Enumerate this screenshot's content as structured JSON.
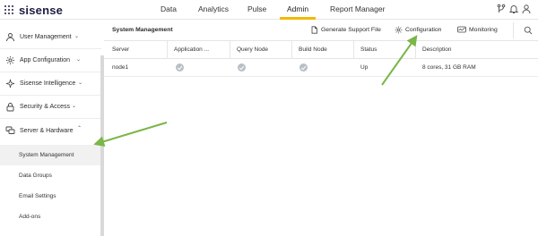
{
  "app": {
    "logo_text": "sisense"
  },
  "topnav": {
    "items": [
      "Data",
      "Analytics",
      "Pulse",
      "Admin",
      "Report Manager"
    ],
    "active": "Admin"
  },
  "top_icons": [
    "branch-icon",
    "bell-icon",
    "user-icon"
  ],
  "sidebar": {
    "sections": [
      {
        "label": "User Management",
        "icon": "user-icon",
        "chevron": "down"
      },
      {
        "label": "App Configuration",
        "icon": "gear-icon",
        "chevron": "down"
      },
      {
        "label": "Sisense Intelligence",
        "icon": "sparkle-icon",
        "chevron": "down"
      },
      {
        "label": "Security & Access",
        "icon": "lock-icon",
        "chevron": "down"
      },
      {
        "label": "Server & Hardware",
        "icon": "server-icon",
        "chevron": "up"
      }
    ],
    "sub_items": [
      "System Management",
      "Data Groups",
      "Email Settings",
      "Add-ons"
    ],
    "selected_sub_item": "System Management"
  },
  "main": {
    "title": "System Management",
    "buttons": {
      "generate_support_file": "Generate Support File",
      "configuration": "Configuration",
      "monitoring": "Monitoring"
    },
    "table": {
      "columns": [
        "Server",
        "Application ...",
        "Query Node",
        "Build Node",
        "Status",
        "Description"
      ],
      "rows": [
        {
          "server": "node1",
          "application": true,
          "query_node": true,
          "build_node": true,
          "status": "Up",
          "description": "8 cores, 31 GB RAM"
        }
      ]
    }
  },
  "colors": {
    "accent": "#f2b900",
    "annotation_arrow": "#7ab648",
    "brand": "#1d1d42"
  }
}
